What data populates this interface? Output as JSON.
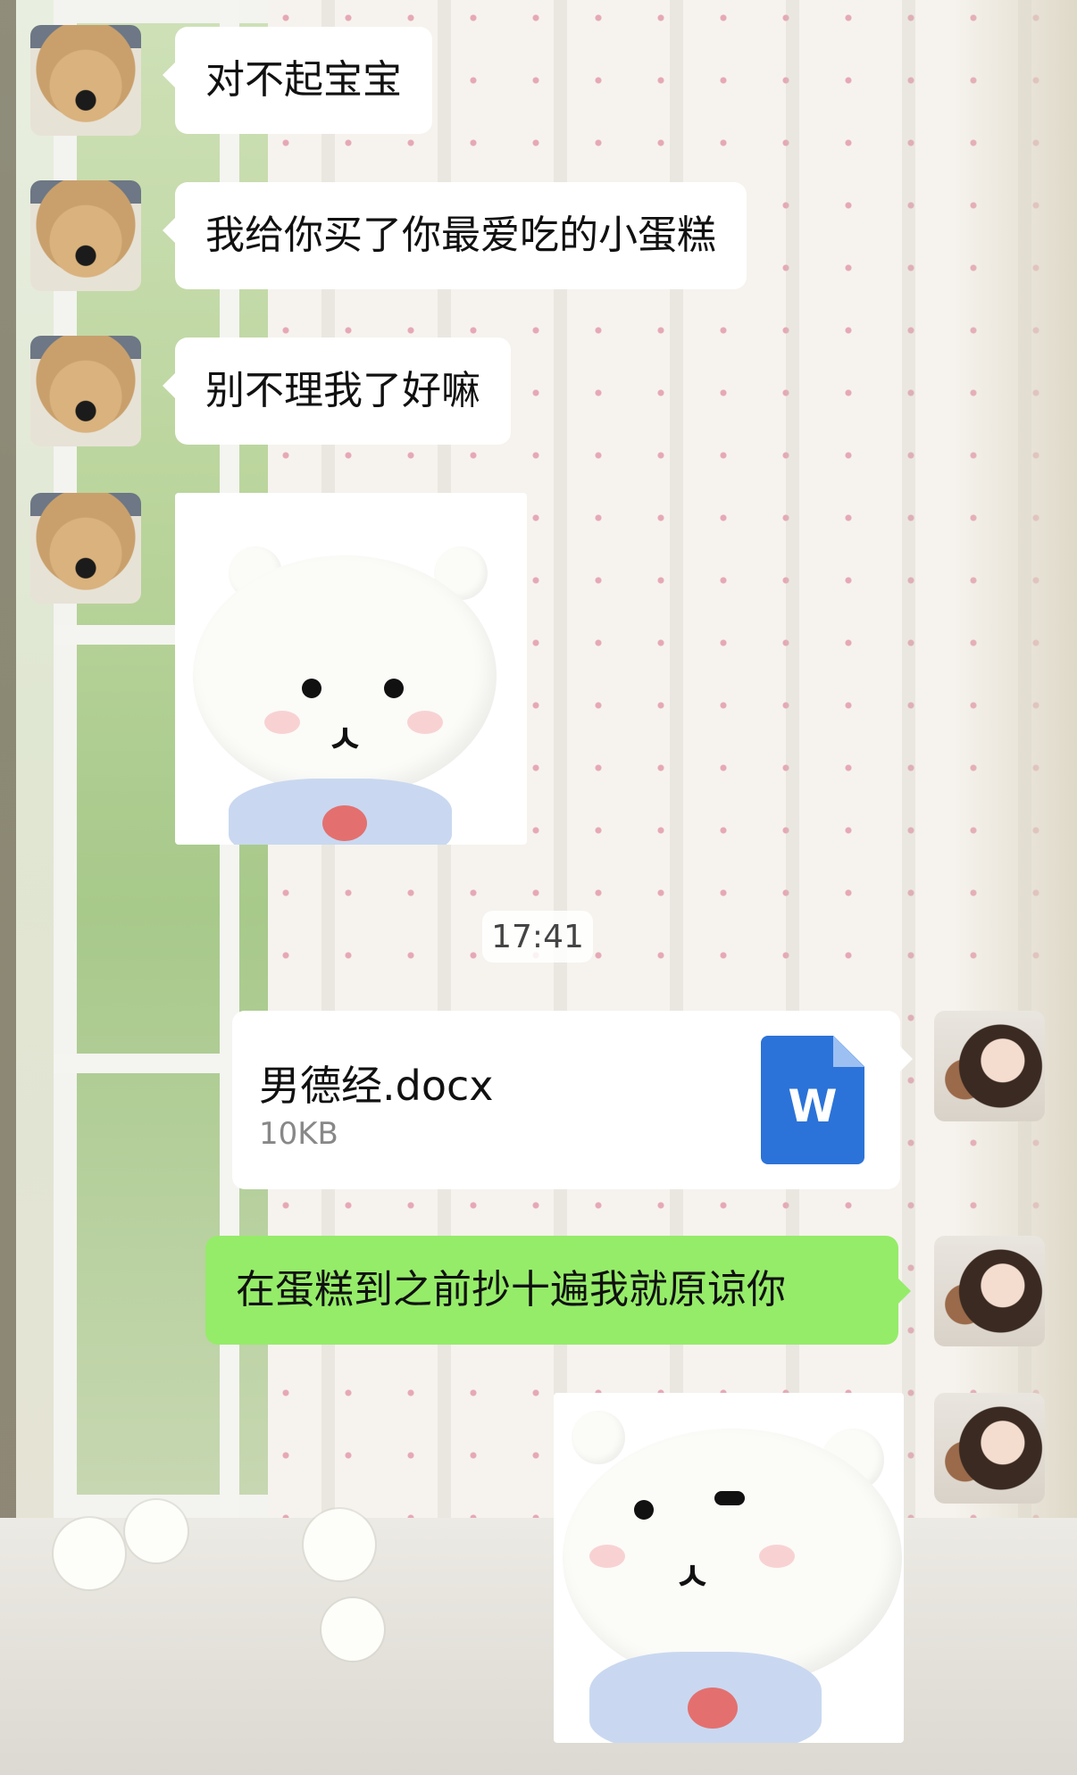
{
  "messages": [
    {
      "side": "left",
      "sender": "dog",
      "text": "对不起宝宝"
    },
    {
      "side": "left",
      "sender": "dog",
      "text": "我给你买了你最爱吃的小蛋糕"
    },
    {
      "side": "left",
      "sender": "dog",
      "text": "别不理我了好嘛"
    },
    {
      "side": "left",
      "sender": "dog",
      "type": "sticker",
      "sticker": "white-bear-sticker"
    },
    {
      "side": "right",
      "sender": "girl",
      "type": "file",
      "file_name": "男德经.docx",
      "file_size": "10KB",
      "icon": "word-doc-icon",
      "icon_letter": "W"
    },
    {
      "side": "right",
      "sender": "girl",
      "text": "在蛋糕到之前抄十遍我就原谅你",
      "bubble_color": "#95ec69"
    },
    {
      "side": "right",
      "sender": "girl",
      "type": "sticker",
      "sticker": "white-bear-sticker-squint"
    }
  ],
  "timestamp": "17:41",
  "colors": {
    "green_bubble": "#95ec69",
    "word_blue": "#2b73d8"
  }
}
